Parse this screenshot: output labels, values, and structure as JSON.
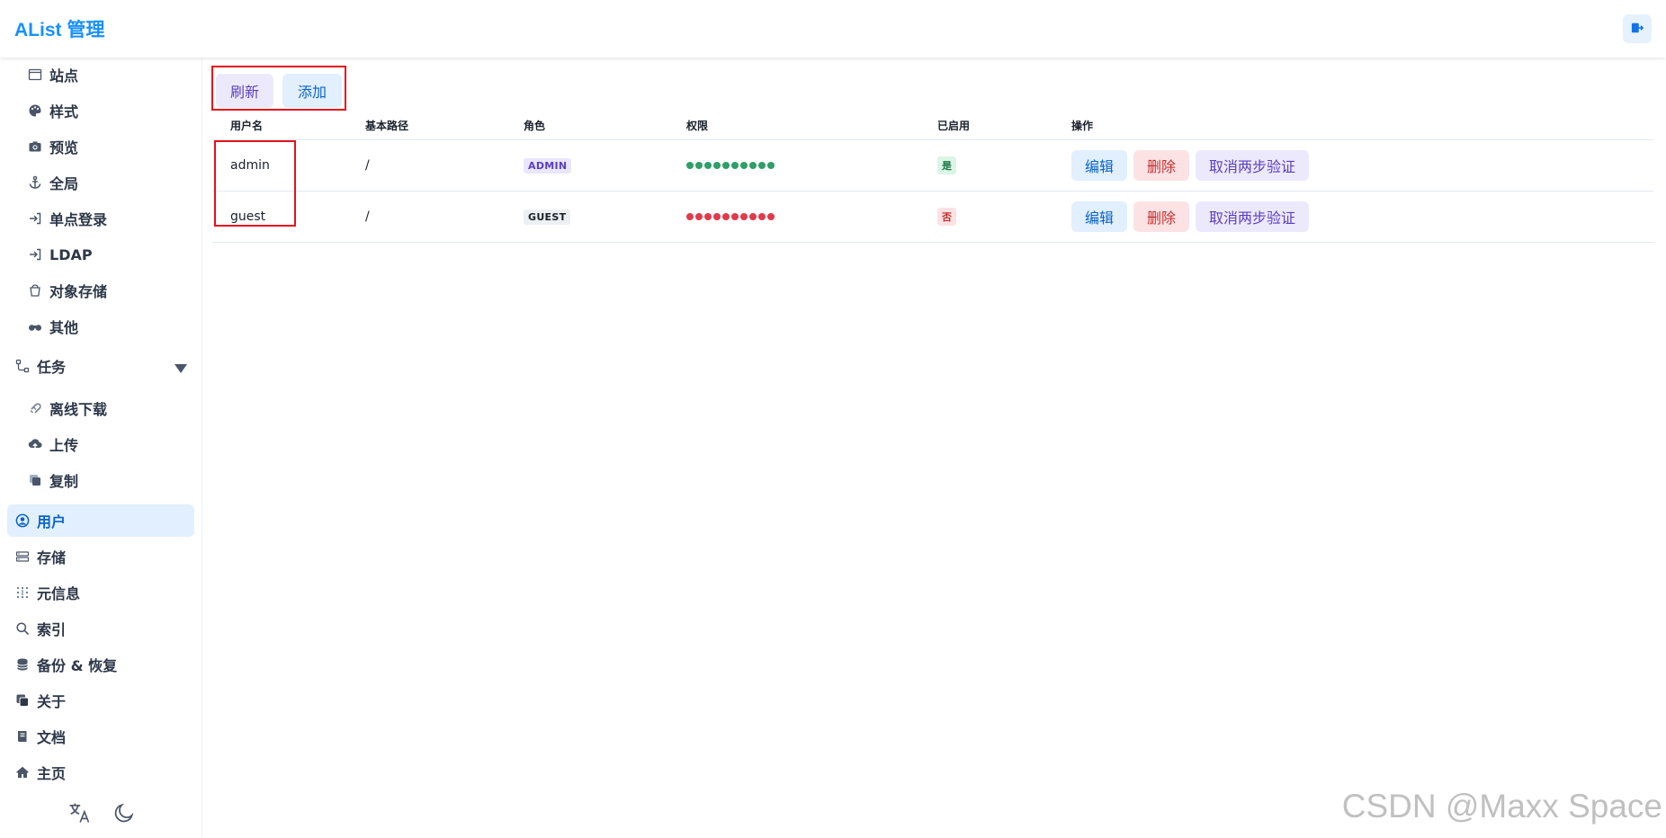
{
  "header": {
    "brand": "AList 管理",
    "logout_icon": "logout-icon"
  },
  "sidebar": {
    "settings_children": [
      {
        "label": "站点",
        "icon": "browser-window-icon"
      },
      {
        "label": "样式",
        "icon": "palette-icon"
      },
      {
        "label": "预览",
        "icon": "camera-icon"
      },
      {
        "label": "全局",
        "icon": "anchor-icon"
      },
      {
        "label": "单点登录",
        "icon": "login-arrow-icon"
      },
      {
        "label": "LDAP",
        "icon": "login-arrow-icon"
      },
      {
        "label": "对象存储",
        "icon": "bucket-icon"
      },
      {
        "label": "其他",
        "icon": "binoculars-icon"
      }
    ],
    "tasks": {
      "label": "任务",
      "icon": "flow-icon",
      "expanded": true
    },
    "task_children": [
      {
        "label": "离线下载",
        "icon": "magnet-icon"
      },
      {
        "label": "上传",
        "icon": "cloud-upload-icon"
      },
      {
        "label": "复制",
        "icon": "copy-icon"
      }
    ],
    "items": [
      {
        "label": "用户",
        "icon": "user-circle-icon",
        "active": true
      },
      {
        "label": "存储",
        "icon": "storage-icon"
      },
      {
        "label": "元信息",
        "icon": "meta-grid-icon"
      },
      {
        "label": "索引",
        "icon": "search-icon"
      },
      {
        "label": "备份 & 恢复",
        "icon": "database-icon"
      },
      {
        "label": "关于",
        "icon": "info-copy-icon"
      },
      {
        "label": "文档",
        "icon": "book-icon"
      },
      {
        "label": "主页",
        "icon": "home-icon"
      }
    ],
    "footer": {
      "language_icon": "translate-icon",
      "theme_icon": "moon-icon"
    }
  },
  "toolbar": {
    "refresh_label": "刷新",
    "add_label": "添加"
  },
  "table": {
    "headers": [
      "用户名",
      "基本路径",
      "角色",
      "权限",
      "已启用",
      "操作"
    ],
    "rows": [
      {
        "username": "admin",
        "base_path": "/",
        "role": "ADMIN",
        "permissions_granted": 10,
        "permissions_total": 10,
        "enabled": "是"
      },
      {
        "username": "guest",
        "base_path": "/",
        "role": "GUEST",
        "permissions_granted": 0,
        "permissions_total": 10,
        "enabled": "否"
      }
    ],
    "actions": {
      "edit": "编辑",
      "delete": "删除",
      "cancel_2fa": "取消两步验证"
    }
  },
  "colors": {
    "brand": "#1890ff",
    "permission_on": "#2f9e68",
    "permission_off": "#e03a4b",
    "annotation_box": "#e5111d"
  },
  "watermark": "CSDN @Maxx Space"
}
